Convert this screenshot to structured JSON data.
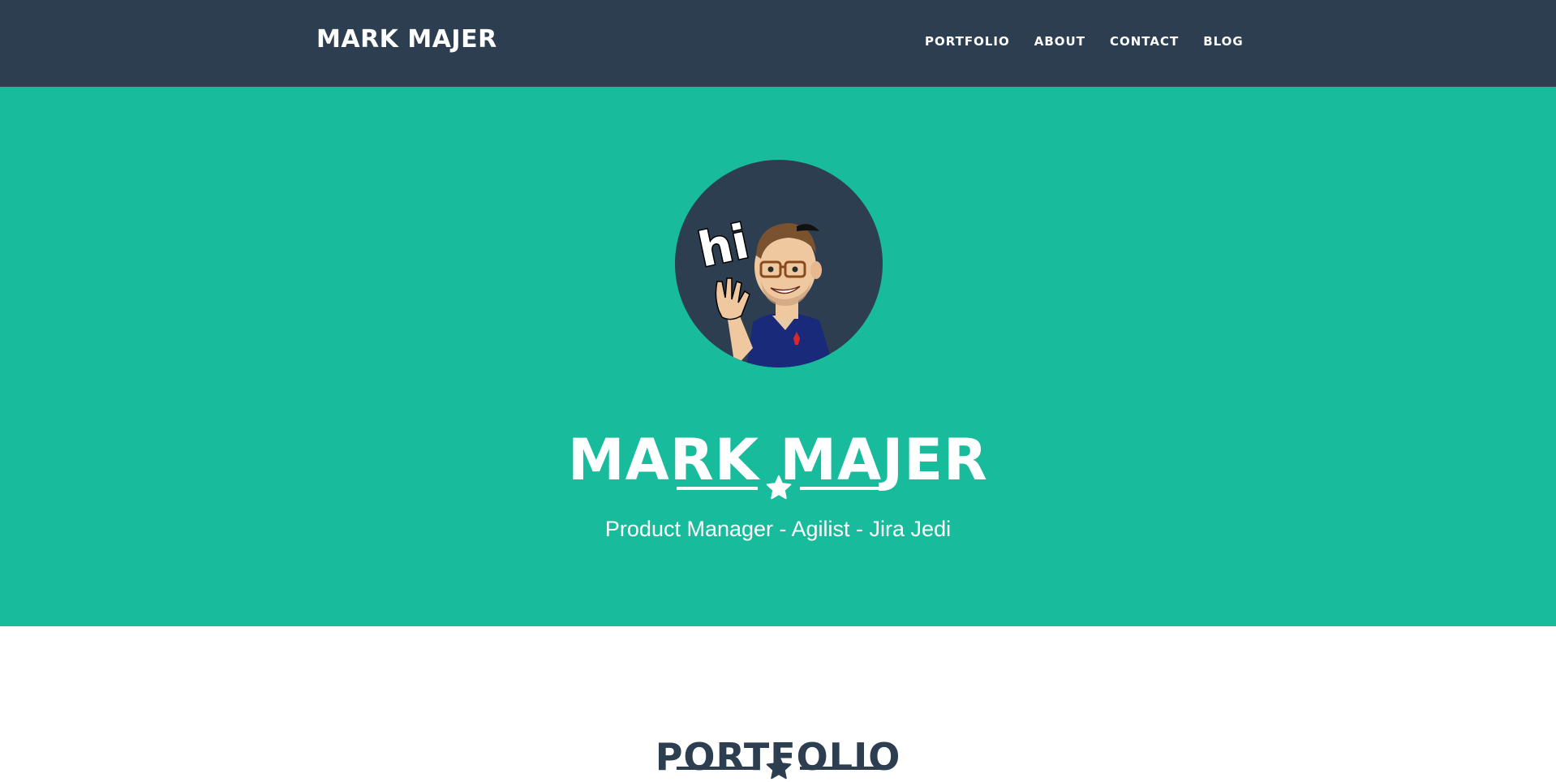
{
  "navbar": {
    "brand": "MARK MAJER",
    "links": [
      {
        "label": "PORTFOLIO"
      },
      {
        "label": "ABOUT"
      },
      {
        "label": "CONTACT"
      },
      {
        "label": "BLOG"
      }
    ]
  },
  "hero": {
    "avatar_icon": "bitmoji-waving-hi-avatar",
    "avatar_text": "hi",
    "title": "MARK MAJER",
    "divider_icon": "star-icon",
    "subtitle": "Product Manager - Agilist - Jira Jedi"
  },
  "portfolio": {
    "title": "PORTFOLIO",
    "divider_icon": "star-icon"
  },
  "colors": {
    "navbar": "#2c3e50",
    "hero": "#18bc9c",
    "text_light": "#ffffff",
    "text_dark": "#2c3e50"
  }
}
